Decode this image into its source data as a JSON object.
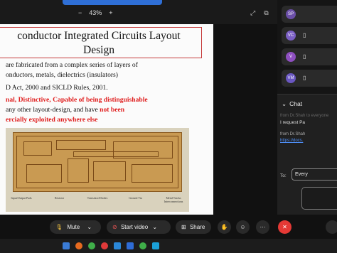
{
  "zoom": {
    "minus": "−",
    "level": "43%",
    "plus": "+"
  },
  "toolbar_top_icons": [
    "share-screen-icon",
    "popout-icon"
  ],
  "slide": {
    "title_line1": "conductor Integrated Circuits Layout",
    "title_line2": "Design",
    "line1": "are fabricated from a complex series of layers of",
    "line2": "onductors, metals, dielectrics (insulators)",
    "line3": "D Act, 2000 and SICLD Rules, 2001.",
    "line4_red": "nal, Distinctive, Capable of being distinguishable",
    "line5_black": "any other layout-design, and have ",
    "line5_red": "not been",
    "line6_red": "ercially exploited anywhere else",
    "image_labels": [
      "Input/Output Pads",
      "Resistor",
      "Transistor/Diodes",
      "Ground Via",
      "Metal Tracks Interconnections"
    ]
  },
  "participants": [
    {
      "initials": "SP",
      "color": "#6b4fa8"
    },
    {
      "initials": "VC",
      "color": "#7b5fc4"
    },
    {
      "initials": "V",
      "color": "#8e4fc0"
    },
    {
      "initials": "VM",
      "color": "#6a57c2"
    }
  ],
  "chat": {
    "header": "Chat",
    "msg_faded": "from Dr.Shah to everyone",
    "msg1": "I request  Pa",
    "from2": "from Dr.Shah",
    "link2": "https://docs.",
    "to_label": "To:",
    "to_value": "Every"
  },
  "controls": {
    "mute": "Mute",
    "start_video": "Start video",
    "share": "Share"
  },
  "colors": {
    "accent": "#2f6fd6",
    "end_call": "#e53935"
  }
}
